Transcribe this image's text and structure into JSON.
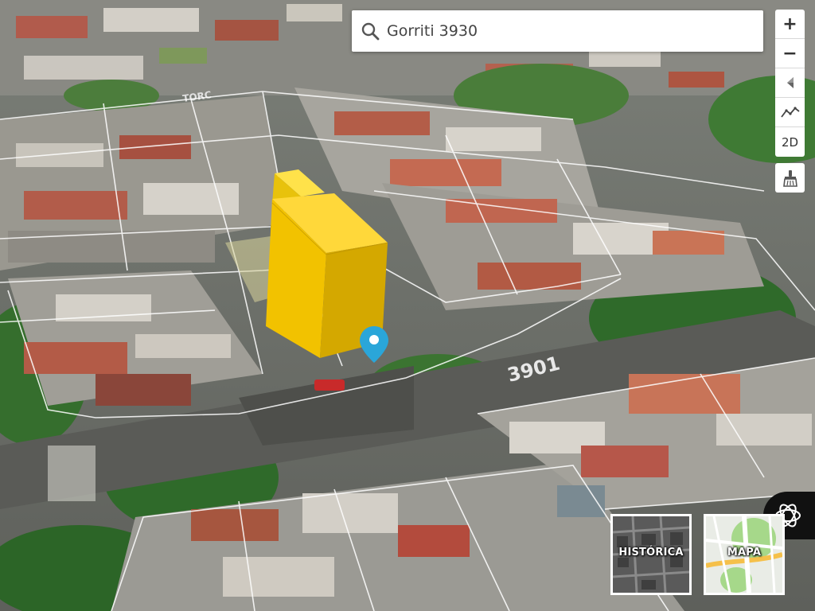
{
  "search": {
    "value": "Gorriti 3930",
    "icon": "search-icon"
  },
  "controls": {
    "zoom_in": "+",
    "zoom_out": "−",
    "compass_icon": "compass-icon",
    "profile_icon": "elevation-profile-icon",
    "mode_2d_label": "2D",
    "paint_icon": "paint-brush-icon"
  },
  "street_labels": {
    "near": "3901",
    "far": "TORC"
  },
  "layers": {
    "historic_label": "HISTÓRICA",
    "map_label": "MAPA"
  },
  "colors": {
    "building_highlight": "#f2c200",
    "marker": "#2aa6d9",
    "parcel_lines": "#ffffff"
  }
}
